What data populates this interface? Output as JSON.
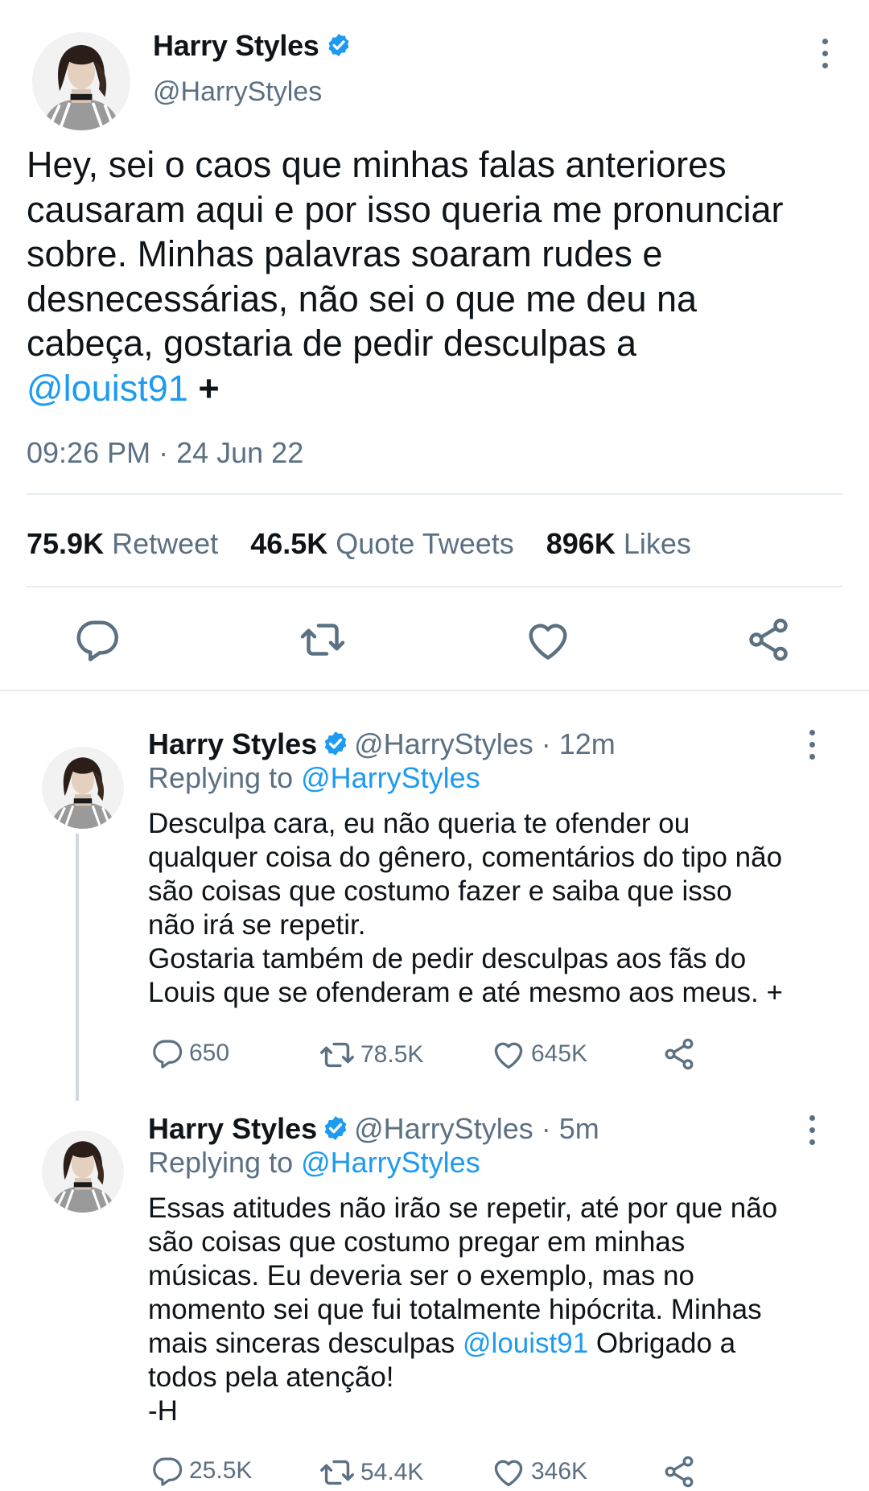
{
  "main_tweet": {
    "author_name": "Harry Styles",
    "author_handle": "@HarryStyles",
    "text_lines": [
      "Hey, sei o caos que minhas falas anteriores",
      "causaram aqui e por isso queria me pronunciar",
      "sobre. Minhas palavras soaram rudes e",
      "desnecessárias, não sei o que me deu na",
      "cabeça, gostaria de pedir desculpas a"
    ],
    "mention": "@louist91",
    "continuation": "+",
    "timestamp": "09:26 PM · 24 Jun 22",
    "stats": {
      "retweets_count": "75.9K",
      "retweets_label": "Retweet",
      "quotes_count": "46.5K",
      "quotes_label": "Quote Tweets",
      "likes_count": "896K",
      "likes_label": "Likes"
    },
    "action_icons": [
      "reply-icon",
      "retweet-icon",
      "like-icon",
      "share-icon"
    ]
  },
  "replies": [
    {
      "author_name": "Harry Styles",
      "author_handle": "@HarryStyles",
      "age": "· 12m",
      "replying_label": "Replying to",
      "replying_to": "@HarryStyles",
      "text_lines": [
        "Desculpa cara, eu não queria te ofender ou",
        "qualquer coisa do gênero, comentários do tipo não",
        "são coisas que costumo fazer e saiba que isso",
        "não irá se repetir.",
        "Gostaria também de pedir desculpas aos fãs do",
        "Louis que se ofenderam e até mesmo aos meus. +"
      ],
      "replies_count": "650",
      "retweets_count": "78.5K",
      "likes_count": "645K"
    },
    {
      "author_name": "Harry Styles",
      "author_handle": "@HarryStyles",
      "age": "· 5m",
      "replying_label": "Replying to",
      "replying_to": "@HarryStyles",
      "text_lines": [
        "Essas atitudes não irão se repetir, até por que não",
        "são coisas que costumo pregar em minhas",
        "músicas. Eu deveria ser o exemplo, mas no",
        "momento sei que fui totalmente hipócrita. Minhas"
      ],
      "line5_before": "mais sinceras desculpas",
      "mention": "@louist91",
      "line5_after": "Obrigado a",
      "line6": "todos pela atenção!",
      "signature": "-H",
      "replies_count": "25.5K",
      "retweets_count": "54.4K",
      "likes_count": "346K"
    }
  ],
  "colors": {
    "link": "#1d9bf0",
    "muted": "#5b7083",
    "text": "#0f1419",
    "divider": "#e6ecf0",
    "verified": "#1d9bf0"
  }
}
